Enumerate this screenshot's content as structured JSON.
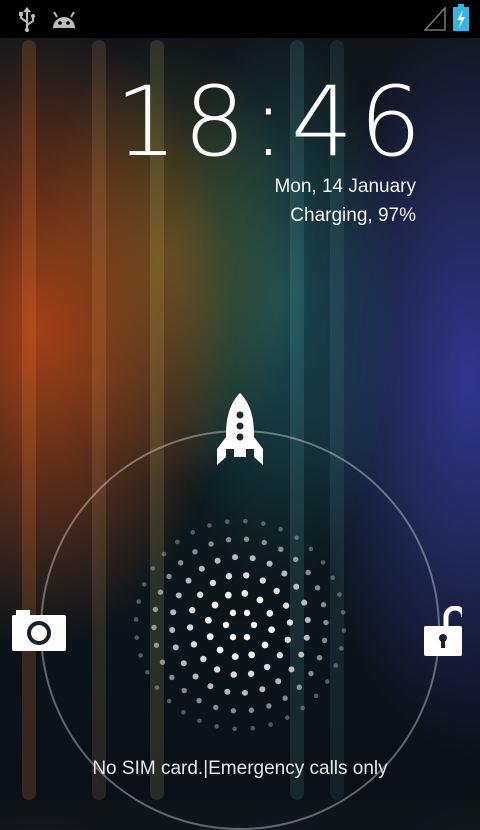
{
  "status_bar": {
    "left_icons": [
      "usb-icon",
      "android-debug-icon"
    ],
    "right_icons": [
      "signal-icon",
      "battery-charging-icon"
    ]
  },
  "clock": {
    "time": "18:46"
  },
  "date_text": "Mon, 14 January",
  "charging_text": "Charging, 97%",
  "unlock_targets": {
    "top": "rocket-icon",
    "left": "camera-icon",
    "right": "unlock-icon"
  },
  "footer_text": "No SIM card.|Emergency calls only",
  "colors": {
    "status_bar": "#000000",
    "text": "#ffffff"
  }
}
